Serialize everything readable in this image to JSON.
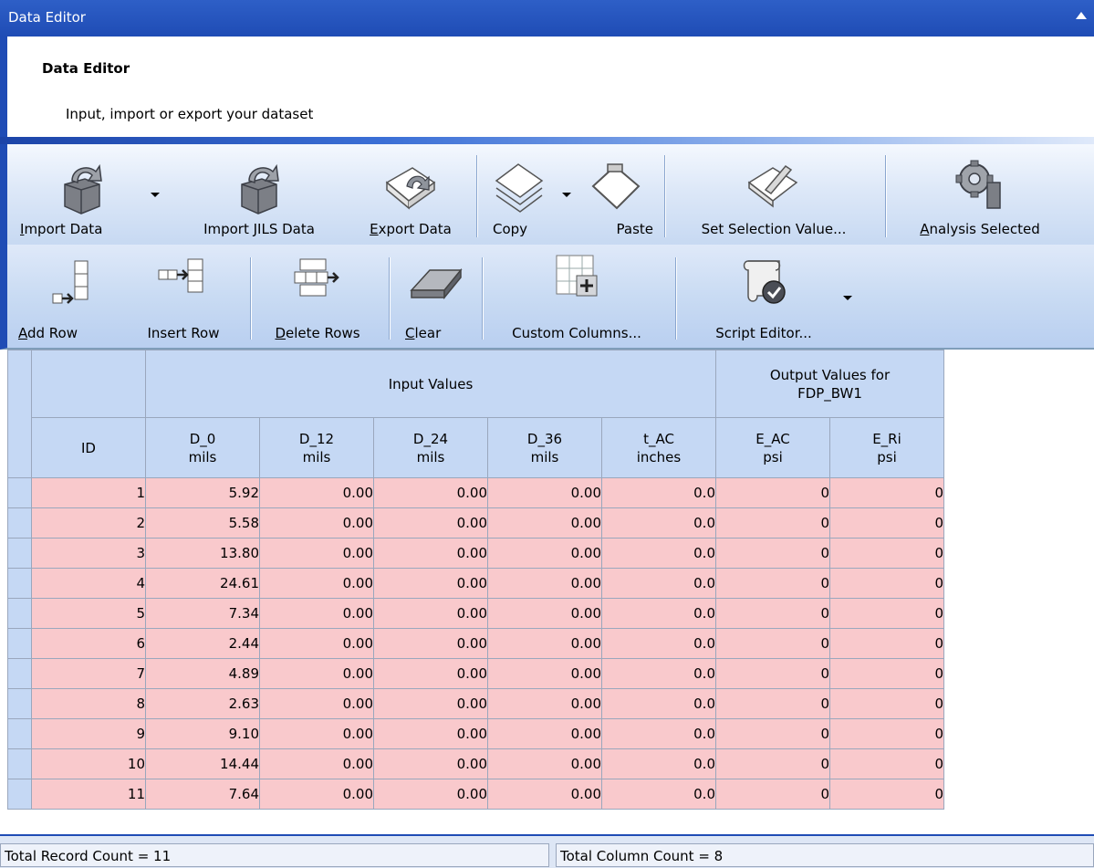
{
  "window": {
    "title": "Data Editor"
  },
  "header": {
    "title": "Data Editor",
    "subtitle": "Input, import or export your dataset"
  },
  "toolbar1": {
    "import_data": {
      "underline": "I",
      "rest": "mport Data"
    },
    "import_jils": "Import JILS Data",
    "export_data": {
      "underline": "E",
      "rest": "xport Data"
    },
    "copy": "Copy",
    "paste": "Paste",
    "set_selection": "Set Selection Value...",
    "analysis_selected": {
      "underline": "A",
      "rest": "nalysis Selected"
    }
  },
  "toolbar2": {
    "add_row": {
      "underline": "A",
      "rest": "dd Row"
    },
    "insert_row": "Insert Row",
    "delete_rows": {
      "underline": "D",
      "rest": "elete Rows"
    },
    "clear": {
      "underline": "C",
      "rest": "lear"
    },
    "custom_columns": "Custom Columns...",
    "script_editor": "Script Editor..."
  },
  "grid": {
    "group_input": "Input Values",
    "group_output_line1": "Output Values for",
    "group_output_line2": "FDP_BW1",
    "columns": [
      {
        "name": "ID",
        "unit": ""
      },
      {
        "name": "D_0",
        "unit": "mils"
      },
      {
        "name": "D_12",
        "unit": "mils"
      },
      {
        "name": "D_24",
        "unit": "mils"
      },
      {
        "name": "D_36",
        "unit": "mils"
      },
      {
        "name": "t_AC",
        "unit": "inches"
      },
      {
        "name": "E_AC",
        "unit": "psi"
      },
      {
        "name": "E_Ri",
        "unit": "psi"
      }
    ],
    "rows": [
      [
        "1",
        "5.92",
        "0.00",
        "0.00",
        "0.00",
        "0.0",
        "0",
        "0"
      ],
      [
        "2",
        "5.58",
        "0.00",
        "0.00",
        "0.00",
        "0.0",
        "0",
        "0"
      ],
      [
        "3",
        "13.80",
        "0.00",
        "0.00",
        "0.00",
        "0.0",
        "0",
        "0"
      ],
      [
        "4",
        "24.61",
        "0.00",
        "0.00",
        "0.00",
        "0.0",
        "0",
        "0"
      ],
      [
        "5",
        "7.34",
        "0.00",
        "0.00",
        "0.00",
        "0.0",
        "0",
        "0"
      ],
      [
        "6",
        "2.44",
        "0.00",
        "0.00",
        "0.00",
        "0.0",
        "0",
        "0"
      ],
      [
        "7",
        "4.89",
        "0.00",
        "0.00",
        "0.00",
        "0.0",
        "0",
        "0"
      ],
      [
        "8",
        "2.63",
        "0.00",
        "0.00",
        "0.00",
        "0.0",
        "0",
        "0"
      ],
      [
        "9",
        "9.10",
        "0.00",
        "0.00",
        "0.00",
        "0.0",
        "0",
        "0"
      ],
      [
        "10",
        "14.44",
        "0.00",
        "0.00",
        "0.00",
        "0.0",
        "0",
        "0"
      ],
      [
        "11",
        "7.64",
        "0.00",
        "0.00",
        "0.00",
        "0.0",
        "0",
        "0"
      ]
    ]
  },
  "status": {
    "record_count": "Total Record Count = 11",
    "column_count": "Total Column Count = 8"
  }
}
